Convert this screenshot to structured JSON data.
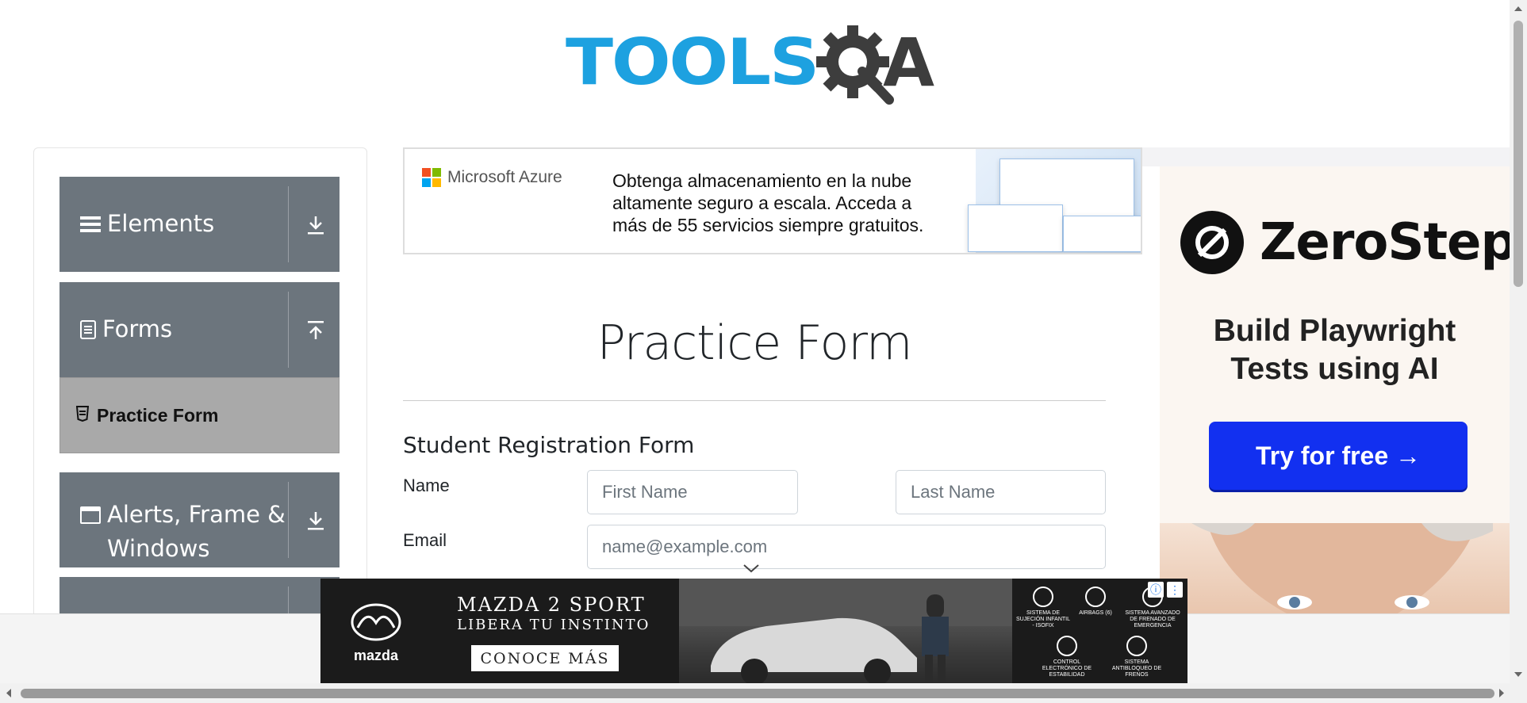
{
  "header": {
    "logo_text": "TOOLS",
    "logo_tail": "A"
  },
  "sidebar": {
    "groups": [
      {
        "label": "Elements",
        "icon": "hamburger-icon",
        "arrow": "download-icon"
      },
      {
        "label": "Forms",
        "icon": "document-icon",
        "arrow": "upload-icon"
      },
      {
        "label": "Alerts, Frame &",
        "label2": "Windows",
        "icon": "window-icon",
        "arrow": "download-icon"
      }
    ],
    "active_item": {
      "label": "Practice Form",
      "icon": "html5-icon"
    }
  },
  "azure_ad": {
    "brand": "Microsoft Azure",
    "line1": "Obtenga almacenamiento en la nube",
    "line2": "altamente seguro a escala. Acceda a",
    "line3": "más de 55 servicios siempre gratuitos.",
    "colors": [
      "#f25022",
      "#7fba00",
      "#00a4ef",
      "#ffb900"
    ]
  },
  "main": {
    "title": "Practice Form",
    "form_title": "Student Registration Form",
    "name_label": "Name",
    "email_label": "Email",
    "first_name_placeholder": "First Name",
    "last_name_placeholder": "Last Name",
    "email_placeholder": "name@example.com"
  },
  "zerostep_ad": {
    "brand": "ZeroStep",
    "line1": "Build Playwright",
    "line2": "Tests using AI",
    "cta": "Try for free →",
    "cta_color": "#1230f0"
  },
  "mazda_ad": {
    "brand": "mazda",
    "headline1": "MAZDA 2 SPORT",
    "headline2": "LIBERA TU INSTINTO",
    "cta": "CONOCE MÁS",
    "features": [
      "SISTEMA DE SUJECIÓN INFANTIL - ISOFIX",
      "AIRBAGS (6)",
      "SISTEMA AVANZADO DE FRENADO DE EMERGENCIA",
      "CONTROL ELECTRÓNICO DE ESTABILIDAD",
      "SISTEMA ANTIBLOQUEO DE FRENOS"
    ],
    "ad_info": "ⓘ",
    "ad_menu": "⋮"
  }
}
